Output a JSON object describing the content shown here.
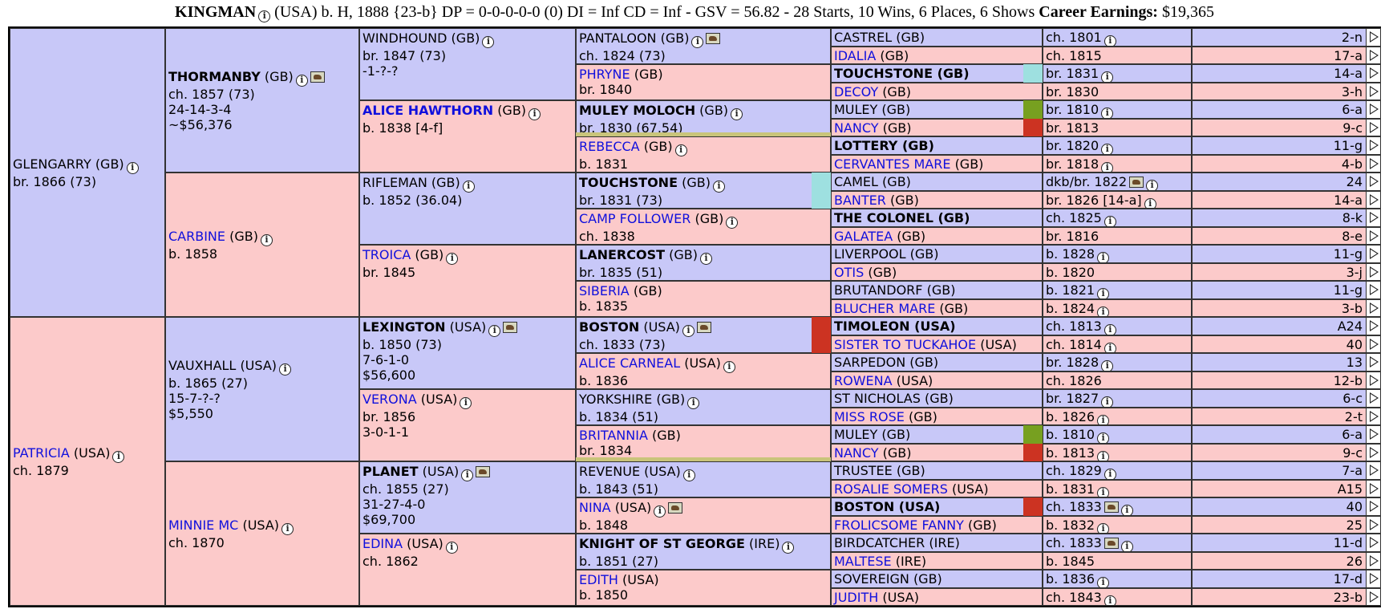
{
  "header": {
    "name": "KINGMAN",
    "details": "(USA) b. H, 1888 {23-b} DP = 0-0-0-0-0 (0) DI = Inf   CD = Inf - GSV = 56.82 - 28 Starts, 10 Wins, 6 Places, 6 Shows",
    "earnings_label": "Career Earnings:",
    "earnings_value": "$19,365"
  },
  "colors": {
    "male_bg": "#c8c8f8",
    "female_bg": "#fccaca",
    "female_name": "#1010dd",
    "teal": "#9ee0e0",
    "green": "#77a020",
    "red": "#cc3322"
  },
  "gen1": [
    {
      "name": "GLENGARRY",
      "country": "(GB)",
      "lines": [
        "br. 1866 (73)"
      ]
    },
    {
      "name": "PATRICIA",
      "country": "(USA)",
      "lines": [
        "ch. 1879"
      ]
    }
  ],
  "gen2": [
    {
      "name": "THORMANBY",
      "country": "(GB)",
      "lines": [
        "ch. 1857 (73)",
        "24-14-3-4",
        "~$56,376"
      ]
    },
    {
      "name": "CARBINE",
      "country": "(GB)",
      "lines": [
        "b. 1858"
      ]
    },
    {
      "name": "VAUXHALL",
      "country": "(USA)",
      "lines": [
        "b. 1865 (27)",
        "15-7-?-?",
        "$5,550"
      ]
    },
    {
      "name": "MINNIE MC",
      "country": "(USA)",
      "lines": [
        "ch. 1870"
      ]
    }
  ],
  "gen3": [
    {
      "name": "WINDHOUND",
      "country": "(GB)",
      "lines": [
        "br. 1847 (73)",
        "-1-?-?"
      ]
    },
    {
      "name": "ALICE HAWTHORN",
      "country": "(GB)",
      "lines": [
        "b. 1838 [4-f]"
      ]
    },
    {
      "name": "RIFLEMAN",
      "country": "(GB)",
      "lines": [
        "b. 1852 (36.04)"
      ]
    },
    {
      "name": "TROICA",
      "country": "(GB)",
      "lines": [
        "br. 1845"
      ]
    },
    {
      "name": "LEXINGTON",
      "country": "(USA)",
      "lines": [
        "b. 1850 (73)",
        "7-6-1-0",
        "$56,600"
      ]
    },
    {
      "name": "VERONA",
      "country": "(USA)",
      "lines": [
        "br. 1856",
        "3-0-1-1"
      ]
    },
    {
      "name": "PLANET",
      "country": "(USA)",
      "lines": [
        "ch. 1855 (27)",
        "31-27-4-0",
        "$69,700"
      ]
    },
    {
      "name": "EDINA",
      "country": "(USA)",
      "lines": [
        "ch. 1862"
      ]
    }
  ],
  "gen4": [
    {
      "name": "PANTALOON",
      "country": "(GB)",
      "lines": [
        "ch. 1824 (73)"
      ]
    },
    {
      "name": "PHRYNE",
      "country": "(GB)",
      "lines": [
        "br. 1840"
      ]
    },
    {
      "name": "MULEY MOLOCH",
      "country": "(GB)",
      "lines": [
        "br. 1830 (67.54)"
      ]
    },
    {
      "name": "REBECCA",
      "country": "(GB)",
      "lines": [
        "b. 1831"
      ]
    },
    {
      "name": "TOUCHSTONE",
      "country": "(GB)",
      "lines": [
        "br. 1831 (73)"
      ]
    },
    {
      "name": "CAMP FOLLOWER",
      "country": "(GB)",
      "lines": [
        "ch. 1838"
      ]
    },
    {
      "name": "LANERCOST",
      "country": "(GB)",
      "lines": [
        "br. 1835 (51)"
      ]
    },
    {
      "name": "SIBERIA",
      "country": "(GB)",
      "lines": [
        "b. 1835"
      ]
    },
    {
      "name": "BOSTON",
      "country": "(USA)",
      "lines": [
        "ch. 1833 (73)"
      ]
    },
    {
      "name": "ALICE CARNEAL",
      "country": "(USA)",
      "lines": [
        "b. 1836"
      ]
    },
    {
      "name": "YORKSHIRE",
      "country": "(GB)",
      "lines": [
        "b. 1834 (51)"
      ]
    },
    {
      "name": "BRITANNIA",
      "country": "(GB)",
      "lines": [
        "br. 1834"
      ]
    },
    {
      "name": "REVENUE",
      "country": "(USA)",
      "lines": [
        "b. 1843 (51)"
      ]
    },
    {
      "name": "NINA",
      "country": "(USA)",
      "lines": [
        "b. 1848"
      ]
    },
    {
      "name": "KNIGHT OF ST GEORGE",
      "country": "(IRE)",
      "lines": [
        "b. 1851 (27)"
      ]
    },
    {
      "name": "EDITH",
      "country": "(USA)",
      "lines": [
        "b. 1850"
      ]
    }
  ],
  "gen5": [
    {
      "name": "CASTREL",
      "country": "(GB)",
      "born": "ch. 1801",
      "family": "2-n"
    },
    {
      "name": "IDALIA",
      "country": "(GB)",
      "born": "ch. 1815",
      "family": "17-a"
    },
    {
      "name": "TOUCHSTONE (GB)",
      "country": "",
      "born": "br. 1831",
      "family": "14-a"
    },
    {
      "name": "DECOY",
      "country": "(GB)",
      "born": "br. 1830",
      "family": "3-h"
    },
    {
      "name": "MULEY",
      "country": "(GB)",
      "born": "br. 1810",
      "family": "6-a"
    },
    {
      "name": "NANCY",
      "country": "(GB)",
      "born": "br. 1813",
      "family": "9-c"
    },
    {
      "name": "LOTTERY (GB)",
      "country": "",
      "born": "br. 1820",
      "family": "11-g"
    },
    {
      "name": "CERVANTES MARE",
      "country": "(GB)",
      "born": "br. 1818",
      "family": "4-b"
    },
    {
      "name": "CAMEL",
      "country": "(GB)",
      "born": "dkb/br. 1822",
      "family": "24"
    },
    {
      "name": "BANTER",
      "country": "(GB)",
      "born": "br. 1826 [14-a]",
      "family": "14-a"
    },
    {
      "name": "THE COLONEL (GB)",
      "country": "",
      "born": "ch. 1825",
      "family": "8-k"
    },
    {
      "name": "GALATEA",
      "country": "(GB)",
      "born": "br. 1816",
      "family": "8-e"
    },
    {
      "name": "LIVERPOOL",
      "country": "(GB)",
      "born": "b. 1828",
      "family": "11-g"
    },
    {
      "name": "OTIS",
      "country": "(GB)",
      "born": "b. 1820",
      "family": "3-j"
    },
    {
      "name": "BRUTANDORF",
      "country": "(GB)",
      "born": "b. 1821",
      "family": "11-g"
    },
    {
      "name": "BLUCHER MARE",
      "country": "(GB)",
      "born": "b. 1824",
      "family": "3-b"
    },
    {
      "name": "TIMOLEON (USA)",
      "country": "",
      "born": "ch. 1813",
      "family": "A24"
    },
    {
      "name": "SISTER TO TUCKAHOE",
      "country": "(USA)",
      "born": "ch. 1814",
      "family": "40"
    },
    {
      "name": "SARPEDON",
      "country": "(GB)",
      "born": "br. 1828",
      "family": "13"
    },
    {
      "name": "ROWENA",
      "country": "(USA)",
      "born": "ch. 1826",
      "family": "12-b"
    },
    {
      "name": "ST NICHOLAS",
      "country": "(GB)",
      "born": "br. 1827",
      "family": "6-c"
    },
    {
      "name": "MISS ROSE",
      "country": "(GB)",
      "born": "b. 1826",
      "family": "2-t"
    },
    {
      "name": "MULEY",
      "country": "(GB)",
      "born": "b. 1810",
      "family": "6-a"
    },
    {
      "name": "NANCY",
      "country": "(GB)",
      "born": "b. 1813",
      "family": "9-c"
    },
    {
      "name": "TRUSTEE",
      "country": "(GB)",
      "born": "ch. 1829",
      "family": "7-a"
    },
    {
      "name": "ROSALIE SOMERS",
      "country": "(USA)",
      "born": "b. 1831",
      "family": "A15"
    },
    {
      "name": "BOSTON (USA)",
      "country": "",
      "born": "ch. 1833",
      "family": "40"
    },
    {
      "name": "FROLICSOME FANNY",
      "country": "(GB)",
      "born": "b. 1832",
      "family": "25"
    },
    {
      "name": "BIRDCATCHER",
      "country": "(IRE)",
      "born": "ch. 1833",
      "family": "11-d"
    },
    {
      "name": "MALTESE",
      "country": "(IRE)",
      "born": "b. 1845",
      "family": "26"
    },
    {
      "name": "SOVEREIGN",
      "country": "(GB)",
      "born": "b. 1836",
      "family": "17-d"
    },
    {
      "name": "JUDITH",
      "country": "(USA)",
      "born": "ch. 1843",
      "family": "23-b"
    }
  ]
}
